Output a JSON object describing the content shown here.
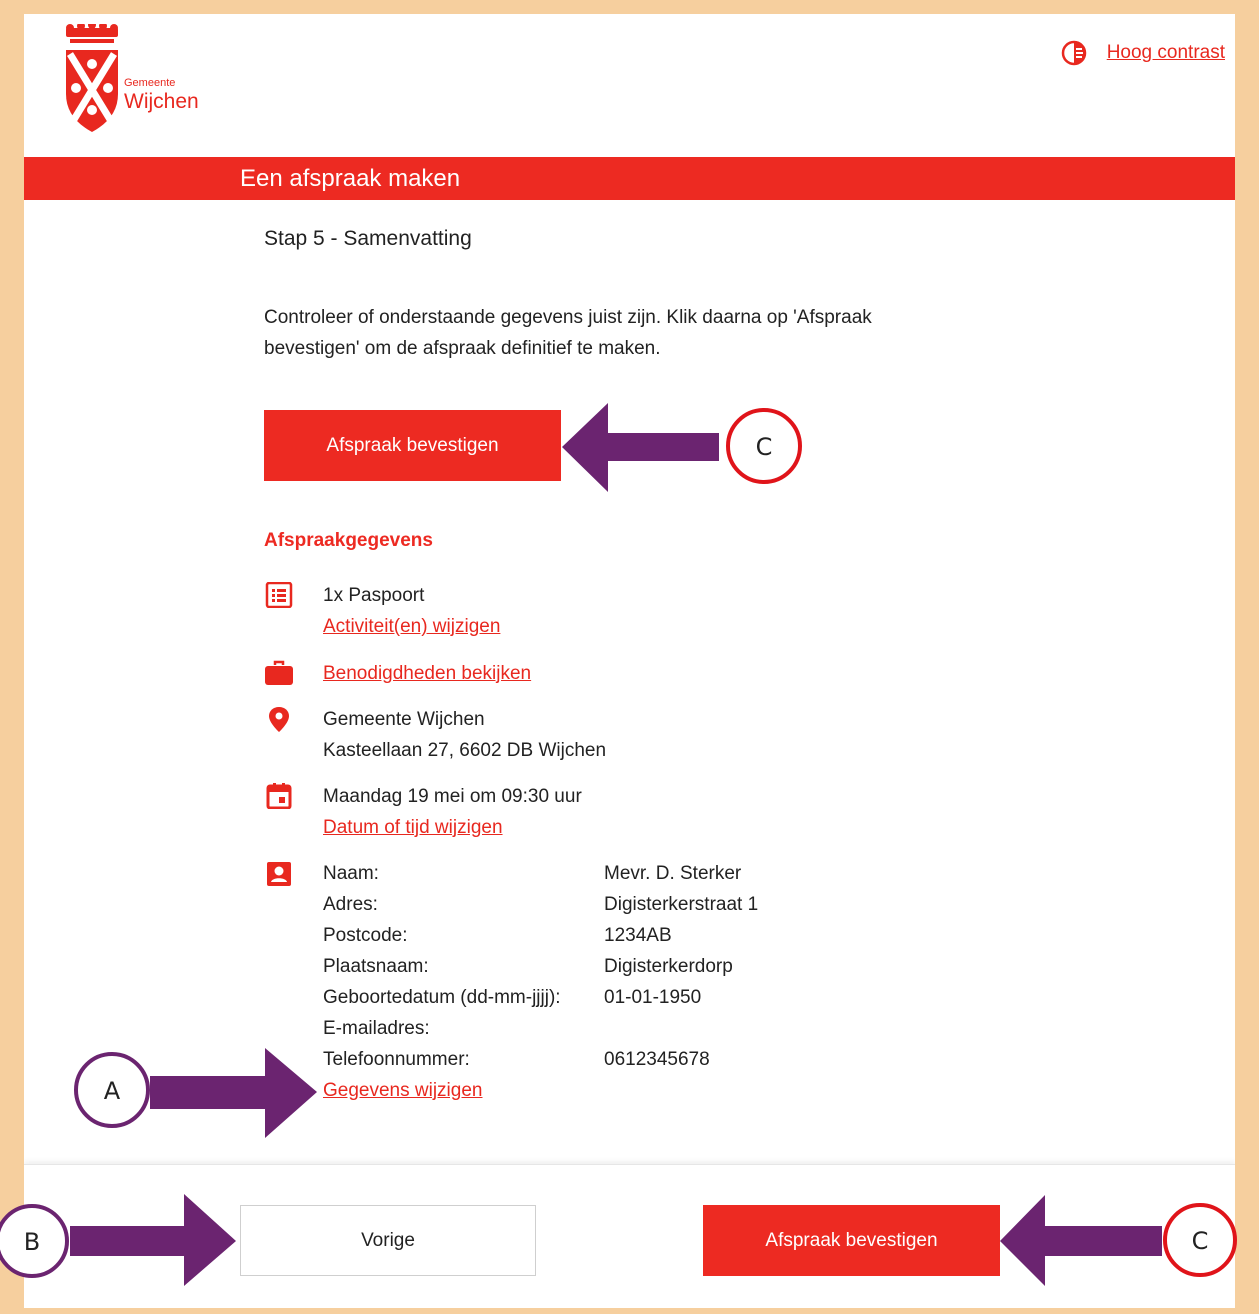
{
  "header": {
    "logo": {
      "line1": "Gemeente",
      "line2": "Wijchen"
    },
    "contrast_icon": "contrast-icon",
    "contrast_label": "Hoog contrast"
  },
  "banner": {
    "title": "Een afspraak maken"
  },
  "step": {
    "title": "Stap 5 - Samenvatting"
  },
  "intro": "Controleer of onderstaande gegevens juist zijn. Klik daarna op 'Afspraak bevestigen' om de afspraak definitief te maken.",
  "confirm_top_label": "Afspraak bevestigen",
  "details": {
    "heading": "Afspraakgegevens",
    "activity": {
      "icon": "list-icon",
      "text": "1x Paspoort",
      "link": "Activiteit(en) wijzigen"
    },
    "requirements": {
      "icon": "briefcase-icon",
      "link": "Benodigdheden bekijken"
    },
    "location": {
      "icon": "location-pin-icon",
      "name": "Gemeente Wijchen",
      "address": "Kasteellaan 27, 6602 DB Wijchen"
    },
    "datetime": {
      "icon": "calendar-icon",
      "text": "Maandag 19 mei om 09:30 uur",
      "link": "Datum of tijd wijzigen"
    },
    "person": {
      "icon": "person-icon",
      "fields": [
        {
          "label": "Naam:",
          "value": "Mevr. D. Sterker"
        },
        {
          "label": "Adres:",
          "value": "Digisterkerstraat 1"
        },
        {
          "label": "Postcode:",
          "value": "1234AB"
        },
        {
          "label": "Plaatsnaam:",
          "value": "Digisterkerdorp"
        },
        {
          "label": "Geboortedatum (dd-mm-jjjj):",
          "value": "01-01-1950"
        },
        {
          "label": "E-mailadres:",
          "value": ""
        },
        {
          "label": "Telefoonnummer:",
          "value": "0612345678"
        }
      ],
      "link": "Gegevens wijzigen"
    }
  },
  "footer": {
    "prev_label": "Vorige",
    "confirm_label": "Afspraak bevestigen"
  },
  "annotations": {
    "marker_a": "A",
    "marker_b": "B",
    "marker_c_top": "C",
    "marker_c_bottom": "C",
    "arrow_color": "#6b2470",
    "circle_ab_color": "#6b2470",
    "circle_c_color": "#e0141a"
  },
  "colors": {
    "brand_red": "#ed2a22",
    "outer_border": "#f6cf9e"
  }
}
